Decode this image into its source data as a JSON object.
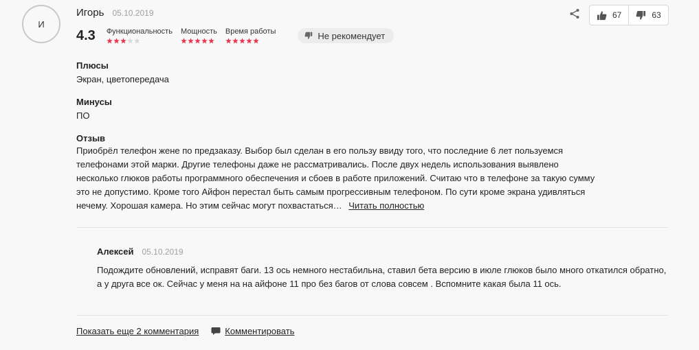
{
  "author": {
    "initial": "И",
    "name": "Игорь",
    "date": "05.10.2019"
  },
  "votes": {
    "up": "67",
    "down": "63"
  },
  "rating": {
    "score": "4.3",
    "criteria": [
      {
        "label": "Функциональность",
        "stars": 3,
        "max": 5
      },
      {
        "label": "Мощность",
        "stars": 5,
        "max": 5
      },
      {
        "label": "Время работы",
        "stars": 5,
        "max": 5
      }
    ],
    "recommendation": "Не рекомендует"
  },
  "pros": {
    "title": "Плюсы",
    "text": "Экран, цветопередача"
  },
  "cons": {
    "title": "Минусы",
    "text": "ПО"
  },
  "review": {
    "title": "Отзыв",
    "text": "Приобрёл телефон жене по предзаказу. Выбор был сделан в его пользу ввиду того, что последние 6 лет пользуемся телефонами этой марки. Другие телефоны даже не рассматривались. После двух недель использования выявлено несколько глюков работы программного обеспечения и сбоев в работе приложений. Считаю что в телефоне за такую сумму это не допустимо. Кроме того Айфон перестал быть самым прогрессивным телефоном. По сути кроме экрана удивляться нечему. Хорошая камера. Но этим сейчас могут похвастаться…",
    "read_more": "Читать полностью"
  },
  "reply": {
    "name": "Алексей",
    "date": "05.10.2019",
    "text": "Подождите обновлений, исправят баги. 13 ось немного нестабильна, ставил бета версию в июле глюков было много откатился обратно, а у друга все ок. Сейчас у меня на на айфоне 11 про без багов от слова совсем . Вспомните какая была 11 ось."
  },
  "actions": {
    "show_more": "Показать еще 2 комментария",
    "comment": "Комментировать"
  },
  "colors": {
    "star_on": "#e8344e",
    "star_off": "#d6d6d6",
    "icon": "#555555"
  }
}
